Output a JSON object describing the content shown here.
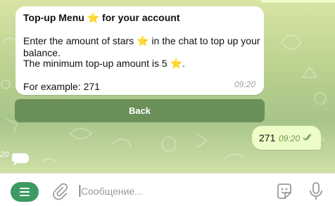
{
  "bot_message": {
    "title": "Top-up Menu",
    "title_suffix": "for your account",
    "line1_a": "Enter the amount of stars",
    "line1_b": "in the chat to top up your",
    "line2": "balance.",
    "line3_a": "The minimum top-up amount is 5",
    "line3_b": ".",
    "example": "For example: 271",
    "time": "09:20",
    "star_icon": "star-emoji"
  },
  "back_button": {
    "label": "Back"
  },
  "user_message": {
    "text": "271",
    "time": "09:20",
    "status_icon": "double-check-icon"
  },
  "stray": {
    "time": "20"
  },
  "composer": {
    "placeholder": "Сообщение...",
    "menu_icon": "menu-icon",
    "attach_icon": "paperclip-icon",
    "sticker_icon": "sticker-icon",
    "mic_icon": "microphone-icon"
  },
  "colors": {
    "menu_button": "#3e9a63",
    "outgoing_bubble": "#eefcc8",
    "keyboard_button": "#5c834e",
    "star": "#f2c12e"
  }
}
